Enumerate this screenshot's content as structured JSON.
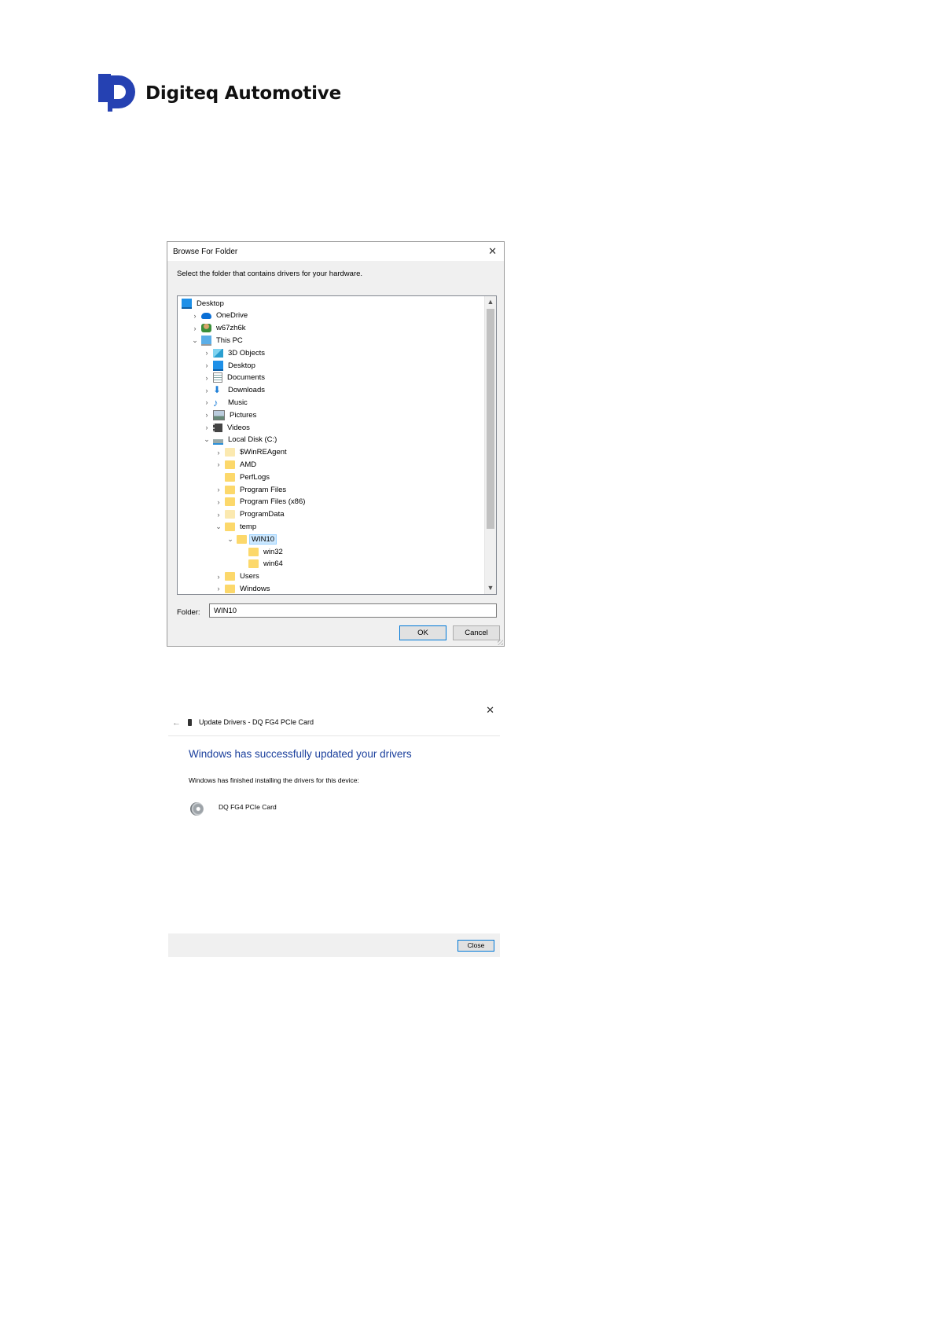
{
  "logo": {
    "text": "Digiteq Automotive",
    "color": "#2541b2"
  },
  "browse_dialog": {
    "title": "Browse For Folder",
    "instruction": "Select the folder that contains drivers for your hardware.",
    "tree": [
      {
        "label": "Desktop",
        "level": 0,
        "chevron": "",
        "icon": "desktop-icon"
      },
      {
        "label": "OneDrive",
        "level": 1,
        "chevron": "›",
        "icon": "cloud-icon"
      },
      {
        "label": "w67zh6k",
        "level": 1,
        "chevron": "›",
        "icon": "user-icon"
      },
      {
        "label": "This PC",
        "level": 1,
        "chevron": "⌄",
        "icon": "computer-icon"
      },
      {
        "label": "3D Objects",
        "level": 2,
        "chevron": "›",
        "icon": "cube-icon"
      },
      {
        "label": "Desktop",
        "level": 2,
        "chevron": "›",
        "icon": "desktop-icon"
      },
      {
        "label": "Documents",
        "level": 2,
        "chevron": "›",
        "icon": "document-icon"
      },
      {
        "label": "Downloads",
        "level": 2,
        "chevron": "›",
        "icon": "download-arrow-icon"
      },
      {
        "label": "Music",
        "level": 2,
        "chevron": "›",
        "icon": "music-note-icon"
      },
      {
        "label": "Pictures",
        "level": 2,
        "chevron": "›",
        "icon": "picture-icon"
      },
      {
        "label": "Videos",
        "level": 2,
        "chevron": "›",
        "icon": "film-icon"
      },
      {
        "label": "Local Disk (C:)",
        "level": 2,
        "chevron": "⌄",
        "icon": "drive-icon"
      },
      {
        "label": "$WinREAgent",
        "level": 3,
        "chevron": "›",
        "icon": "folder-pale-icon"
      },
      {
        "label": "AMD",
        "level": 3,
        "chevron": "›",
        "icon": "folder-icon"
      },
      {
        "label": "PerfLogs",
        "level": 3,
        "chevron": "",
        "icon": "folder-icon"
      },
      {
        "label": "Program Files",
        "level": 3,
        "chevron": "›",
        "icon": "folder-icon"
      },
      {
        "label": "Program Files (x86)",
        "level": 3,
        "chevron": "›",
        "icon": "folder-icon"
      },
      {
        "label": "ProgramData",
        "level": 3,
        "chevron": "›",
        "icon": "folder-pale-icon"
      },
      {
        "label": "temp",
        "level": 3,
        "chevron": "⌄",
        "icon": "folder-icon"
      },
      {
        "label": "WIN10",
        "level": 4,
        "chevron": "⌄",
        "icon": "folder-icon",
        "selected": true
      },
      {
        "label": "win32",
        "level": 5,
        "chevron": "",
        "icon": "folder-icon"
      },
      {
        "label": "win64",
        "level": 5,
        "chevron": "",
        "icon": "folder-icon"
      },
      {
        "label": "Users",
        "level": 3,
        "chevron": "›",
        "icon": "folder-icon"
      },
      {
        "label": "Windows",
        "level": 3,
        "chevron": "›",
        "icon": "folder-icon"
      }
    ],
    "folder_label": "Folder:",
    "folder_value": "WIN10",
    "ok_label": "OK",
    "cancel_label": "Cancel"
  },
  "update_dialog": {
    "title": "Update Drivers - DQ FG4 PCIe Card",
    "heading": "Windows has successfully updated your drivers",
    "description": "Windows has finished installing the drivers for this device:",
    "device_name": "DQ FG4 PCIe Card",
    "close_label": "Close",
    "heading_color": "#1a3f9c"
  }
}
